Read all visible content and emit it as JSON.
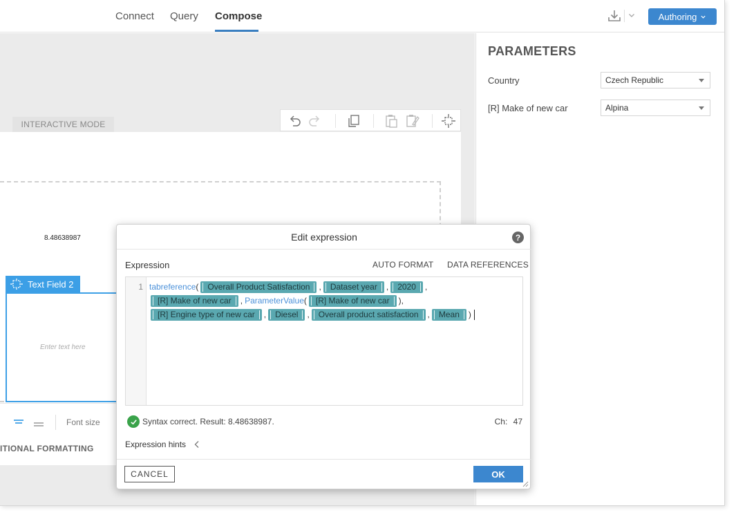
{
  "nav": {
    "tabs": [
      "Connect",
      "Query",
      "Compose"
    ],
    "active": "Compose",
    "authoring_label": "Authoring"
  },
  "canvas": {
    "mode_tab": "INTERACTIVE MODE",
    "value_text": "8.48638987",
    "text_field_label": "Text Field 2",
    "text_placeholder": "Enter text here",
    "font_size_label": "Font size",
    "conditional_formatting": "ITIONAL FORMATTING"
  },
  "parameters": {
    "title": "PARAMETERS",
    "items": [
      {
        "label": "Country",
        "value": "Czech Republic"
      },
      {
        "label": "[R] Make of new car",
        "value": "Alpina"
      }
    ]
  },
  "dialog": {
    "title": "Edit expression",
    "help": "?",
    "expression_label": "Expression",
    "auto_format": "AUTO FORMAT",
    "data_references": "DATA REFERENCES",
    "line_number": "1",
    "code": {
      "fn1": "tabreference",
      "fn2": "ParameterValue",
      "tokens": [
        "Overall Product Satisfaction",
        "Dataset year",
        "2020",
        "[R] Make of new car",
        "[R] Make of new car",
        "[R] Engine type of new car",
        "Diesel",
        "Overall product satisfaction",
        "Mean"
      ]
    },
    "status": "Syntax correct. Result: 8.48638987.",
    "char_label": "Ch:",
    "char_count": "47",
    "hints_label": "Expression hints",
    "cancel_label": "CANCEL",
    "ok_label": "OK"
  },
  "colors": {
    "accent": "#3c87cf",
    "token": "#5aa8b0",
    "function": "#4a90d9",
    "selection": "#3c9fe6",
    "success": "#3aa34a"
  }
}
